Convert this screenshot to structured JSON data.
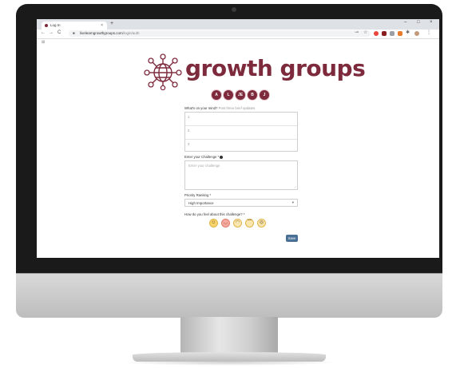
{
  "browser": {
    "tab_title": "Log In",
    "tab_close": "×",
    "new_tab": "+",
    "window_controls": [
      "–",
      "□",
      "×"
    ],
    "url_domain": "livelearngrowthgroups.com",
    "url_path": "/login/auth",
    "nav": [
      "←",
      "→",
      "C"
    ]
  },
  "app": {
    "logo_text": "growth groups",
    "avatars": [
      "A",
      "L",
      "JE",
      "B",
      "J"
    ],
    "brand_color": "#7d2a3c"
  },
  "form": {
    "mind_label": "What's on your mind?",
    "mind_hint": "Post three brief updates",
    "mind_lines": [
      "1",
      "2",
      "3"
    ],
    "challenge_label": "Enter your Challenge *",
    "challenge_placeholder": "Enter your challenge",
    "priority_label": "Priority Ranking *",
    "priority_value": "High Importance",
    "priority_caret": "▾",
    "feel_label": "How do you feel about this challenge? *",
    "emojis": [
      "☺",
      "◡",
      "◠",
      "︶",
      "◎"
    ],
    "save_label": "Save",
    "resize_handle": "⟋"
  }
}
